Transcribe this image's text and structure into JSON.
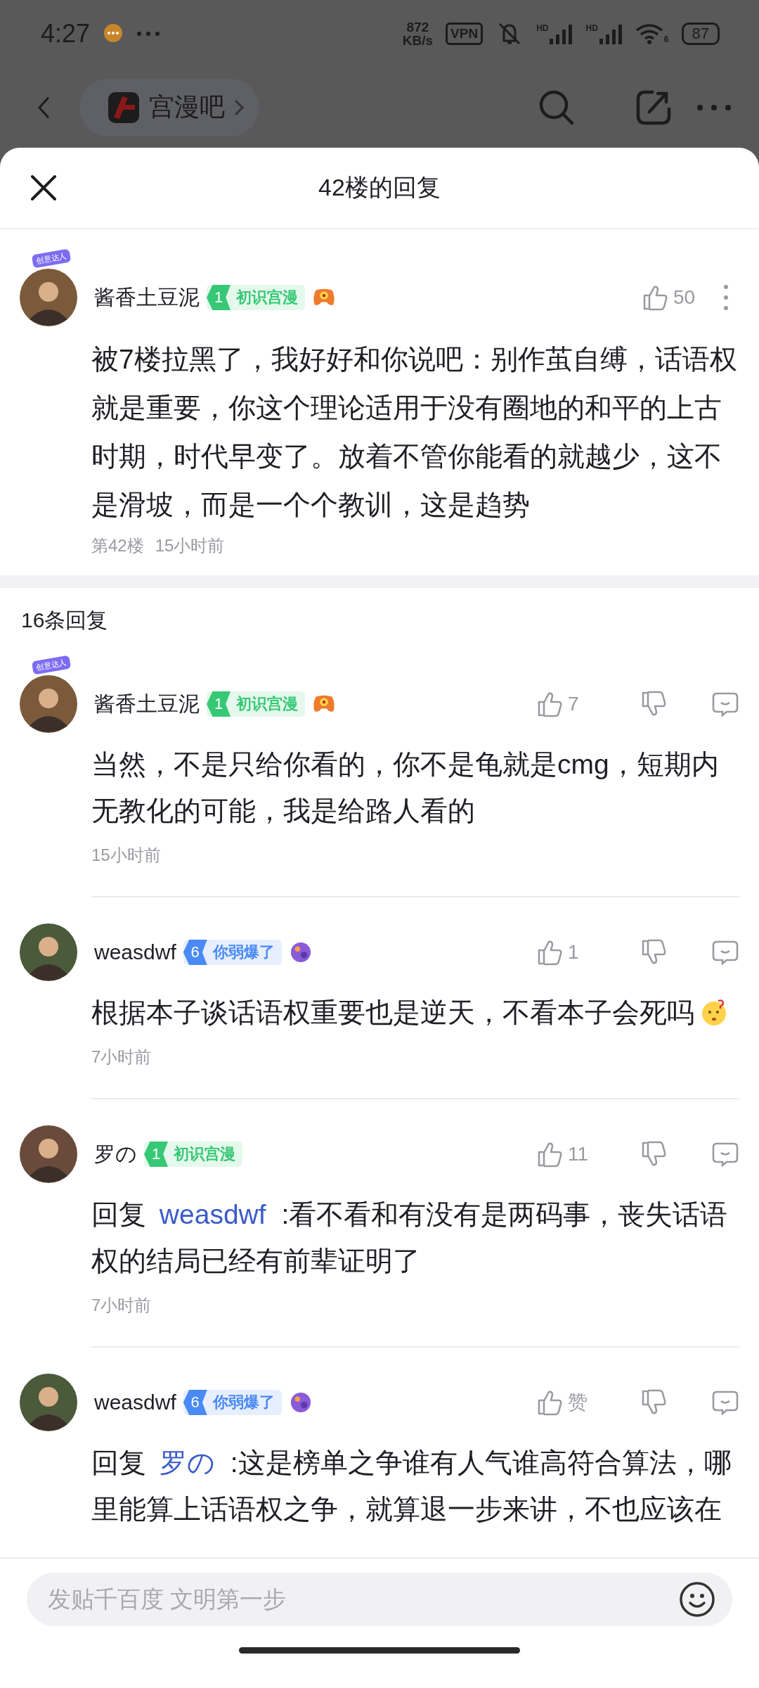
{
  "status_bar": {
    "time": "4:27",
    "net_speed": "872",
    "net_unit": "KB/s",
    "vpn": "VPN",
    "hd": [
      "HD",
      "HD"
    ],
    "wifi_label": "6",
    "battery": "87"
  },
  "nav": {
    "forum": "宫漫吧"
  },
  "sheet": {
    "title": "42楼的回复"
  },
  "main_comment": {
    "user": "酱香土豆泥",
    "frame_label": "创意达人",
    "badge": {
      "level": "1",
      "title": "初识宫漫",
      "color": "#36c874"
    },
    "emblem": {
      "kind": "gamepad"
    },
    "likes": "50",
    "text": "被7楼拉黑了，我好好和你说吧：别作茧自缚，话语权就是重要，你这个理论适用于没有圈地的和平的上古时期，时代早变了。放着不管你能看的就越少，这不是滑坡，而是一个个教训，这是趋势",
    "floor": "第42楼",
    "time": "15小时前"
  },
  "reply_count": "16条回复",
  "replies": [
    {
      "user": "酱香土豆泥",
      "frame_label": "创意达人",
      "badge": {
        "level": "1",
        "title": "初识宫漫",
        "color": "#36c874"
      },
      "emblem": {
        "kind": "gamepad"
      },
      "likes": "7",
      "text": "当然，不是只给你看的，你不是龟就是cmg，短期内无教化的可能，我是给路人看的",
      "time": "15小时前"
    },
    {
      "user": "weasdwf",
      "badge": {
        "level": "6",
        "title": "你弱爆了",
        "color": "#4a8af4"
      },
      "emblem": {
        "kind": "orb"
      },
      "likes": "1",
      "text": "根据本子谈话语权重要也是逆天，不看本子会死吗",
      "sticker": {
        "kind": "puzzled"
      },
      "time": "7小时前"
    },
    {
      "user": "罗の",
      "badge": {
        "level": "1",
        "title": "初识宫漫",
        "color": "#36c874"
      },
      "likes": "11",
      "reply_prefix": "回复",
      "reply_to": "weasdwf",
      "text": ":看不看和有没有是两码事，丧失话语权的结局已经有前辈证明了",
      "time": "7小时前"
    },
    {
      "user": "weasdwf",
      "badge": {
        "level": "6",
        "title": "你弱爆了",
        "color": "#4a8af4"
      },
      "emblem": {
        "kind": "orb"
      },
      "likes": "赞",
      "reply_prefix": "回复",
      "reply_to": "罗の",
      "text": ":这是榜单之争谁有人气谁高符合算法，哪里能算上话语权之争，就算退一步来讲，不也应该在"
    }
  ],
  "composer": {
    "placeholder": "发贴千百度 文明第一步"
  }
}
